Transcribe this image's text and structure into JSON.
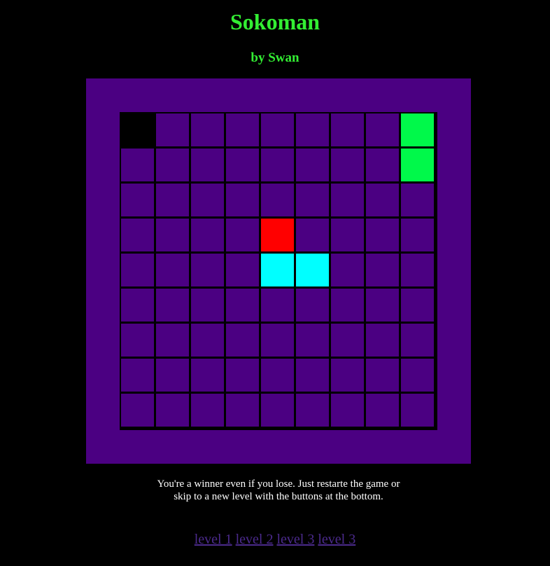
{
  "header": {
    "title": "Sokoman",
    "subtitle": "by Swan"
  },
  "board": {
    "rows": 9,
    "cols": 9,
    "colors": {
      "frame": "#4b0082",
      "floor": "#4b0082",
      "void": "#000000",
      "goal": "#00f94a",
      "player": "#ff0000",
      "box": "#00ffff"
    },
    "cells": [
      [
        "void",
        "floor",
        "floor",
        "floor",
        "floor",
        "floor",
        "floor",
        "floor",
        "goal"
      ],
      [
        "floor",
        "floor",
        "floor",
        "floor",
        "floor",
        "floor",
        "floor",
        "floor",
        "goal"
      ],
      [
        "floor",
        "floor",
        "floor",
        "floor",
        "floor",
        "floor",
        "floor",
        "floor",
        "floor"
      ],
      [
        "floor",
        "floor",
        "floor",
        "floor",
        "player",
        "floor",
        "floor",
        "floor",
        "floor"
      ],
      [
        "floor",
        "floor",
        "floor",
        "floor",
        "box",
        "box",
        "floor",
        "floor",
        "floor"
      ],
      [
        "floor",
        "floor",
        "floor",
        "floor",
        "floor",
        "floor",
        "floor",
        "floor",
        "floor"
      ],
      [
        "floor",
        "floor",
        "floor",
        "floor",
        "floor",
        "floor",
        "floor",
        "floor",
        "floor"
      ],
      [
        "floor",
        "floor",
        "floor",
        "floor",
        "floor",
        "floor",
        "floor",
        "floor",
        "floor"
      ],
      [
        "floor",
        "floor",
        "floor",
        "floor",
        "floor",
        "floor",
        "floor",
        "floor",
        "floor"
      ]
    ]
  },
  "message": {
    "line1": "You're a winner even if you lose. Just restarte the game or",
    "line2": "skip to a new level with the buttons at the bottom."
  },
  "levels": [
    {
      "label": "level 1"
    },
    {
      "label": "level 2"
    },
    {
      "label": "level 3"
    },
    {
      "label": "level 3"
    }
  ]
}
